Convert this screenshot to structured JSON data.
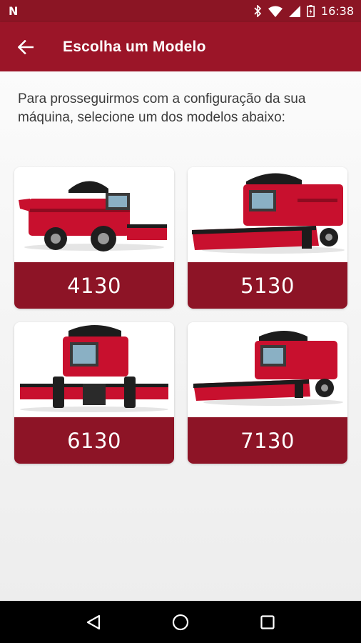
{
  "status_bar": {
    "logo": "N",
    "time": "16:38",
    "icons": [
      "bluetooth-icon",
      "wifi-icon",
      "signal-icon",
      "battery-icon"
    ]
  },
  "toolbar": {
    "back_icon": "arrow-left-icon",
    "title": "Escolha um Modelo"
  },
  "intro_text": "Para prosseguirmos com a configuração da sua máquina, selecione um dos modelos abaixo:",
  "models": [
    {
      "label": "4130",
      "image": "combine-harvester-side-view"
    },
    {
      "label": "5130",
      "image": "combine-harvester-front-quarter-view"
    },
    {
      "label": "6130",
      "image": "combine-harvester-front-view"
    },
    {
      "label": "7130",
      "image": "combine-harvester-front-quarter-view"
    }
  ],
  "colors": {
    "status_bar": "#8b1524",
    "toolbar": "#9b1528",
    "card_label": "#8d1426",
    "machine_red": "#c8102e"
  },
  "nav_bar": {
    "buttons": [
      "back-triangle-icon",
      "home-circle-icon",
      "recents-square-icon"
    ]
  }
}
